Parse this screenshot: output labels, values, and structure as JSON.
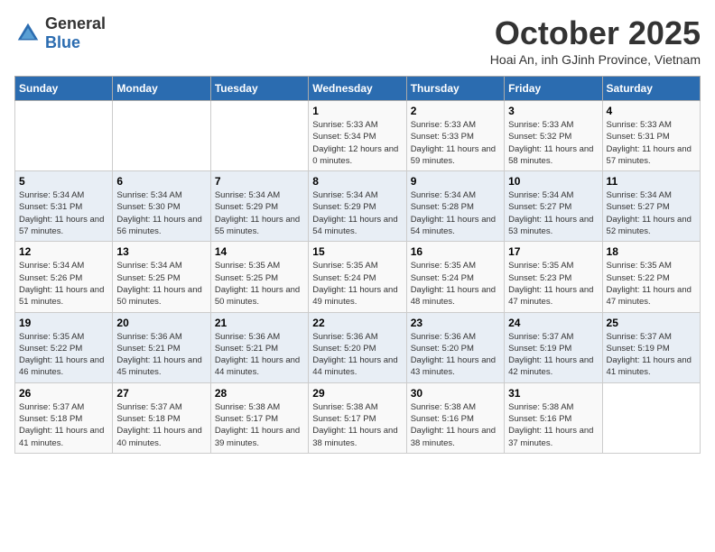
{
  "logo": {
    "general": "General",
    "blue": "Blue"
  },
  "header": {
    "title": "October 2025",
    "subtitle": "Hoai An, inh GJinh Province, Vietnam"
  },
  "weekdays": [
    "Sunday",
    "Monday",
    "Tuesday",
    "Wednesday",
    "Thursday",
    "Friday",
    "Saturday"
  ],
  "weeks": [
    [
      {
        "day": "",
        "sunrise": "",
        "sunset": "",
        "daylight": ""
      },
      {
        "day": "",
        "sunrise": "",
        "sunset": "",
        "daylight": ""
      },
      {
        "day": "",
        "sunrise": "",
        "sunset": "",
        "daylight": ""
      },
      {
        "day": "1",
        "sunrise": "Sunrise: 5:33 AM",
        "sunset": "Sunset: 5:34 PM",
        "daylight": "Daylight: 12 hours and 0 minutes."
      },
      {
        "day": "2",
        "sunrise": "Sunrise: 5:33 AM",
        "sunset": "Sunset: 5:33 PM",
        "daylight": "Daylight: 11 hours and 59 minutes."
      },
      {
        "day": "3",
        "sunrise": "Sunrise: 5:33 AM",
        "sunset": "Sunset: 5:32 PM",
        "daylight": "Daylight: 11 hours and 58 minutes."
      },
      {
        "day": "4",
        "sunrise": "Sunrise: 5:33 AM",
        "sunset": "Sunset: 5:31 PM",
        "daylight": "Daylight: 11 hours and 57 minutes."
      }
    ],
    [
      {
        "day": "5",
        "sunrise": "Sunrise: 5:34 AM",
        "sunset": "Sunset: 5:31 PM",
        "daylight": "Daylight: 11 hours and 57 minutes."
      },
      {
        "day": "6",
        "sunrise": "Sunrise: 5:34 AM",
        "sunset": "Sunset: 5:30 PM",
        "daylight": "Daylight: 11 hours and 56 minutes."
      },
      {
        "day": "7",
        "sunrise": "Sunrise: 5:34 AM",
        "sunset": "Sunset: 5:29 PM",
        "daylight": "Daylight: 11 hours and 55 minutes."
      },
      {
        "day": "8",
        "sunrise": "Sunrise: 5:34 AM",
        "sunset": "Sunset: 5:29 PM",
        "daylight": "Daylight: 11 hours and 54 minutes."
      },
      {
        "day": "9",
        "sunrise": "Sunrise: 5:34 AM",
        "sunset": "Sunset: 5:28 PM",
        "daylight": "Daylight: 11 hours and 54 minutes."
      },
      {
        "day": "10",
        "sunrise": "Sunrise: 5:34 AM",
        "sunset": "Sunset: 5:27 PM",
        "daylight": "Daylight: 11 hours and 53 minutes."
      },
      {
        "day": "11",
        "sunrise": "Sunrise: 5:34 AM",
        "sunset": "Sunset: 5:27 PM",
        "daylight": "Daylight: 11 hours and 52 minutes."
      }
    ],
    [
      {
        "day": "12",
        "sunrise": "Sunrise: 5:34 AM",
        "sunset": "Sunset: 5:26 PM",
        "daylight": "Daylight: 11 hours and 51 minutes."
      },
      {
        "day": "13",
        "sunrise": "Sunrise: 5:34 AM",
        "sunset": "Sunset: 5:25 PM",
        "daylight": "Daylight: 11 hours and 50 minutes."
      },
      {
        "day": "14",
        "sunrise": "Sunrise: 5:35 AM",
        "sunset": "Sunset: 5:25 PM",
        "daylight": "Daylight: 11 hours and 50 minutes."
      },
      {
        "day": "15",
        "sunrise": "Sunrise: 5:35 AM",
        "sunset": "Sunset: 5:24 PM",
        "daylight": "Daylight: 11 hours and 49 minutes."
      },
      {
        "day": "16",
        "sunrise": "Sunrise: 5:35 AM",
        "sunset": "Sunset: 5:24 PM",
        "daylight": "Daylight: 11 hours and 48 minutes."
      },
      {
        "day": "17",
        "sunrise": "Sunrise: 5:35 AM",
        "sunset": "Sunset: 5:23 PM",
        "daylight": "Daylight: 11 hours and 47 minutes."
      },
      {
        "day": "18",
        "sunrise": "Sunrise: 5:35 AM",
        "sunset": "Sunset: 5:22 PM",
        "daylight": "Daylight: 11 hours and 47 minutes."
      }
    ],
    [
      {
        "day": "19",
        "sunrise": "Sunrise: 5:35 AM",
        "sunset": "Sunset: 5:22 PM",
        "daylight": "Daylight: 11 hours and 46 minutes."
      },
      {
        "day": "20",
        "sunrise": "Sunrise: 5:36 AM",
        "sunset": "Sunset: 5:21 PM",
        "daylight": "Daylight: 11 hours and 45 minutes."
      },
      {
        "day": "21",
        "sunrise": "Sunrise: 5:36 AM",
        "sunset": "Sunset: 5:21 PM",
        "daylight": "Daylight: 11 hours and 44 minutes."
      },
      {
        "day": "22",
        "sunrise": "Sunrise: 5:36 AM",
        "sunset": "Sunset: 5:20 PM",
        "daylight": "Daylight: 11 hours and 44 minutes."
      },
      {
        "day": "23",
        "sunrise": "Sunrise: 5:36 AM",
        "sunset": "Sunset: 5:20 PM",
        "daylight": "Daylight: 11 hours and 43 minutes."
      },
      {
        "day": "24",
        "sunrise": "Sunrise: 5:37 AM",
        "sunset": "Sunset: 5:19 PM",
        "daylight": "Daylight: 11 hours and 42 minutes."
      },
      {
        "day": "25",
        "sunrise": "Sunrise: 5:37 AM",
        "sunset": "Sunset: 5:19 PM",
        "daylight": "Daylight: 11 hours and 41 minutes."
      }
    ],
    [
      {
        "day": "26",
        "sunrise": "Sunrise: 5:37 AM",
        "sunset": "Sunset: 5:18 PM",
        "daylight": "Daylight: 11 hours and 41 minutes."
      },
      {
        "day": "27",
        "sunrise": "Sunrise: 5:37 AM",
        "sunset": "Sunset: 5:18 PM",
        "daylight": "Daylight: 11 hours and 40 minutes."
      },
      {
        "day": "28",
        "sunrise": "Sunrise: 5:38 AM",
        "sunset": "Sunset: 5:17 PM",
        "daylight": "Daylight: 11 hours and 39 minutes."
      },
      {
        "day": "29",
        "sunrise": "Sunrise: 5:38 AM",
        "sunset": "Sunset: 5:17 PM",
        "daylight": "Daylight: 11 hours and 38 minutes."
      },
      {
        "day": "30",
        "sunrise": "Sunrise: 5:38 AM",
        "sunset": "Sunset: 5:16 PM",
        "daylight": "Daylight: 11 hours and 38 minutes."
      },
      {
        "day": "31",
        "sunrise": "Sunrise: 5:38 AM",
        "sunset": "Sunset: 5:16 PM",
        "daylight": "Daylight: 11 hours and 37 minutes."
      },
      {
        "day": "",
        "sunrise": "",
        "sunset": "",
        "daylight": ""
      }
    ]
  ]
}
